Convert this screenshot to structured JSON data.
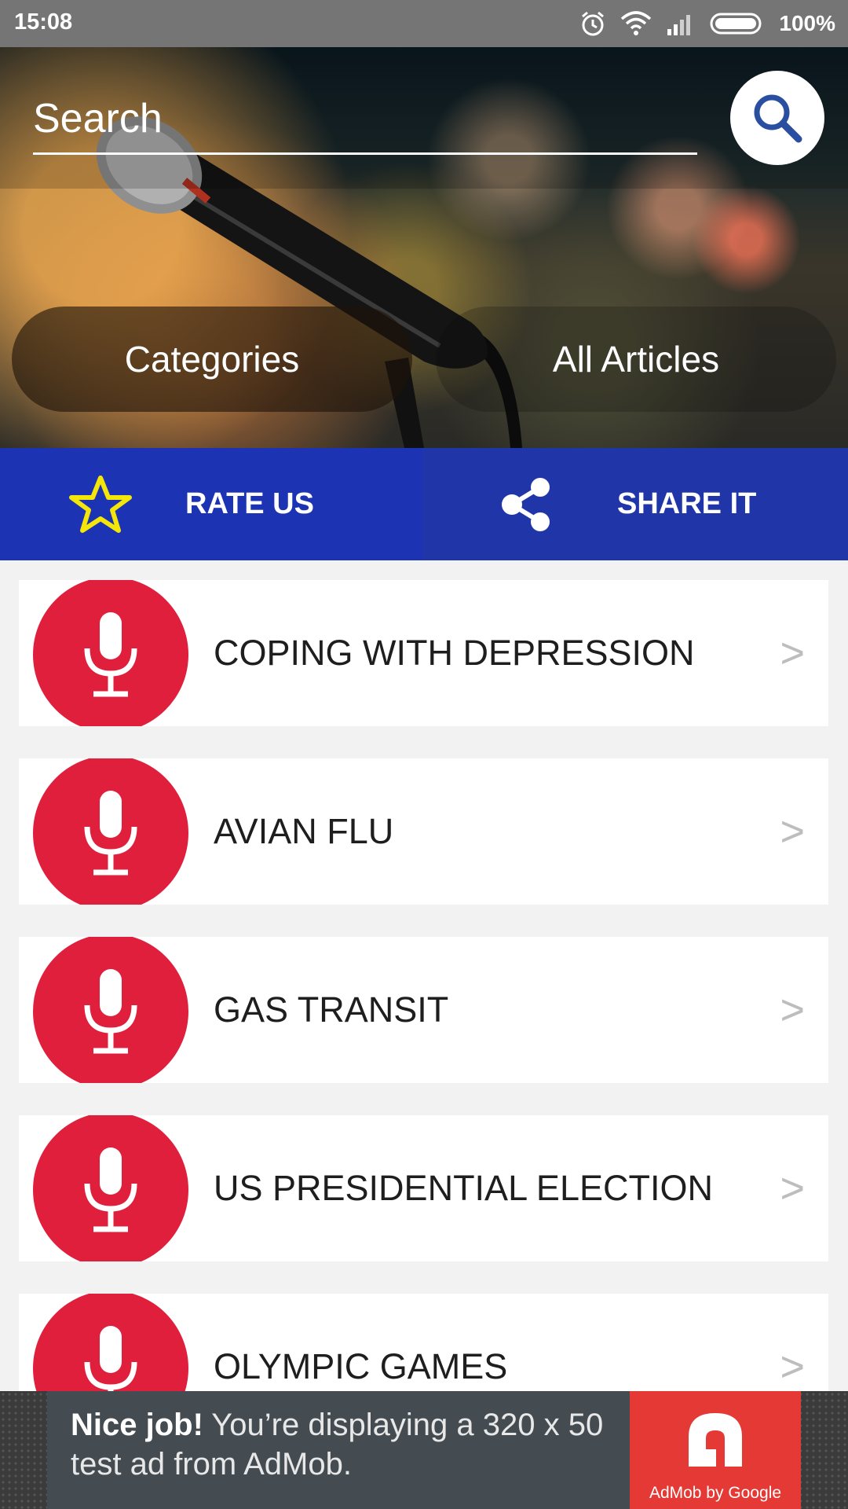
{
  "status_bar": {
    "time": "15:08",
    "battery": "100%"
  },
  "search": {
    "placeholder": "Search"
  },
  "tabs": {
    "categories": "Categories",
    "all_articles": "All Articles"
  },
  "actions": {
    "rate_label": "RATE US",
    "share_label": "SHARE IT"
  },
  "articles": [
    {
      "title": "COPING WITH DEPRESSION",
      "chevron": ">"
    },
    {
      "title": "AVIAN FLU",
      "chevron": ">"
    },
    {
      "title": "GAS TRANSIT",
      "chevron": ">"
    },
    {
      "title": "US PRESIDENTIAL ELECTION",
      "chevron": ">"
    },
    {
      "title": "OLYMPIC GAMES",
      "chevron": ">"
    }
  ],
  "ad": {
    "headline": "Nice job!",
    "body": " You’re displaying a 320 x 50 test ad from AdMob.",
    "brand": "AdMob by Google"
  },
  "colors": {
    "action_bar": "#1c33b3",
    "avatar_red": "#e01f3d",
    "star_yellow": "#f5e60a",
    "search_icon_blue": "#2b4fa0"
  },
  "icons": [
    "alarm-icon",
    "wifi-icon",
    "signal-icon",
    "battery-icon",
    "search-icon",
    "star-icon",
    "share-icon",
    "microphone-icon",
    "chevron-right-icon",
    "admob-logo-icon"
  ]
}
